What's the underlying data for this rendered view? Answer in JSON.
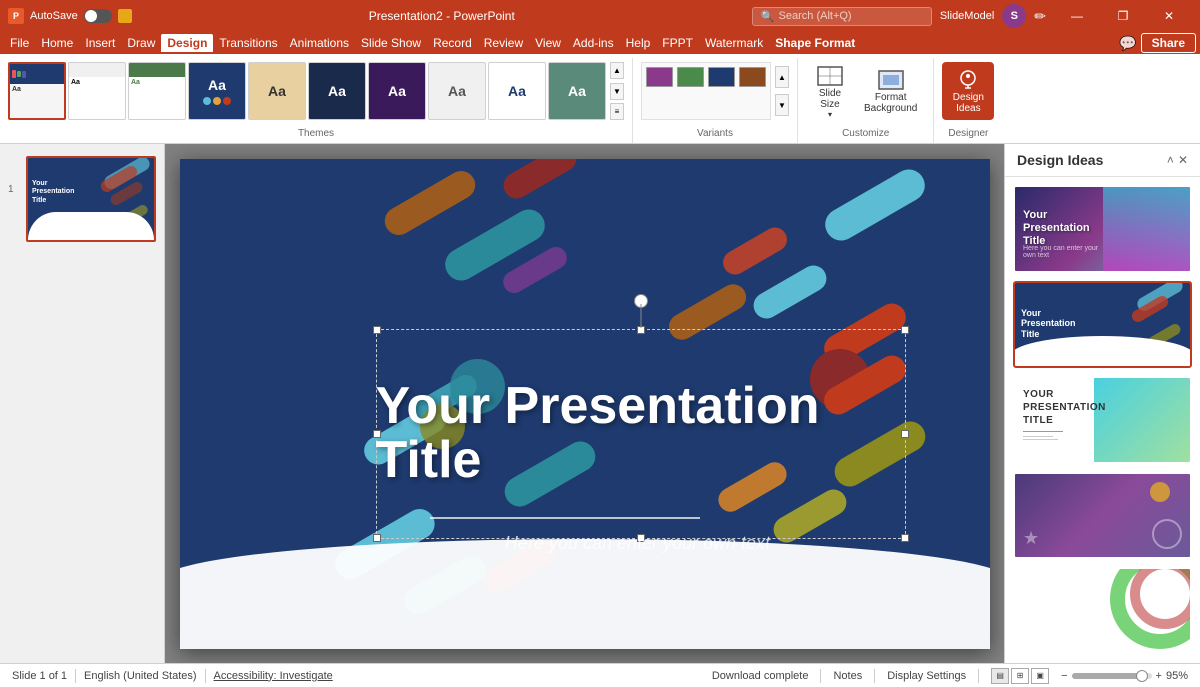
{
  "titlebar": {
    "autosave_label": "AutoSave",
    "toggle_state": "off",
    "filename": "Presentation2 - PowerPoint",
    "search_placeholder": "Search (Alt+Q)",
    "user_initials": "S",
    "win_minimize": "—",
    "win_restore": "❐",
    "win_close": "✕",
    "edit_icon": "✏",
    "slidemodel_label": "SlideModel"
  },
  "ribbon": {
    "menu_items": [
      "File",
      "Home",
      "Insert",
      "Draw",
      "Design",
      "Transitions",
      "Animations",
      "Slide Show",
      "Record",
      "Review",
      "View",
      "Add-ins",
      "Help",
      "FPPT",
      "Watermark",
      "Shape Format"
    ],
    "active_tab": "Design",
    "themes_label": "Themes",
    "variants_label": "Variants",
    "customize_label": "Customize",
    "designer_label": "Designer",
    "slide_size_label": "Slide\nSize",
    "format_bg_label": "Format\nBackground",
    "design_ideas_label": "Design\nIdeas",
    "share_label": "Share",
    "comments_icon": "💬"
  },
  "design_panel": {
    "title": "Design Ideas",
    "close_label": "✕",
    "collapse_label": "˄"
  },
  "slide": {
    "title": "Your Presentation Title",
    "subtitle": "Here you can enter your own text"
  },
  "status_bar": {
    "slide_count": "Slide 1 of 1",
    "language": "English (United States)",
    "accessibility": "Accessibility: Investigate",
    "download": "Download complete",
    "notes": "Notes",
    "display_settings": "Display Settings",
    "zoom_level": "95%"
  },
  "colors": {
    "accent": "#c03b1e",
    "slide_bg": "#1e3a6e",
    "title_text": "white"
  }
}
